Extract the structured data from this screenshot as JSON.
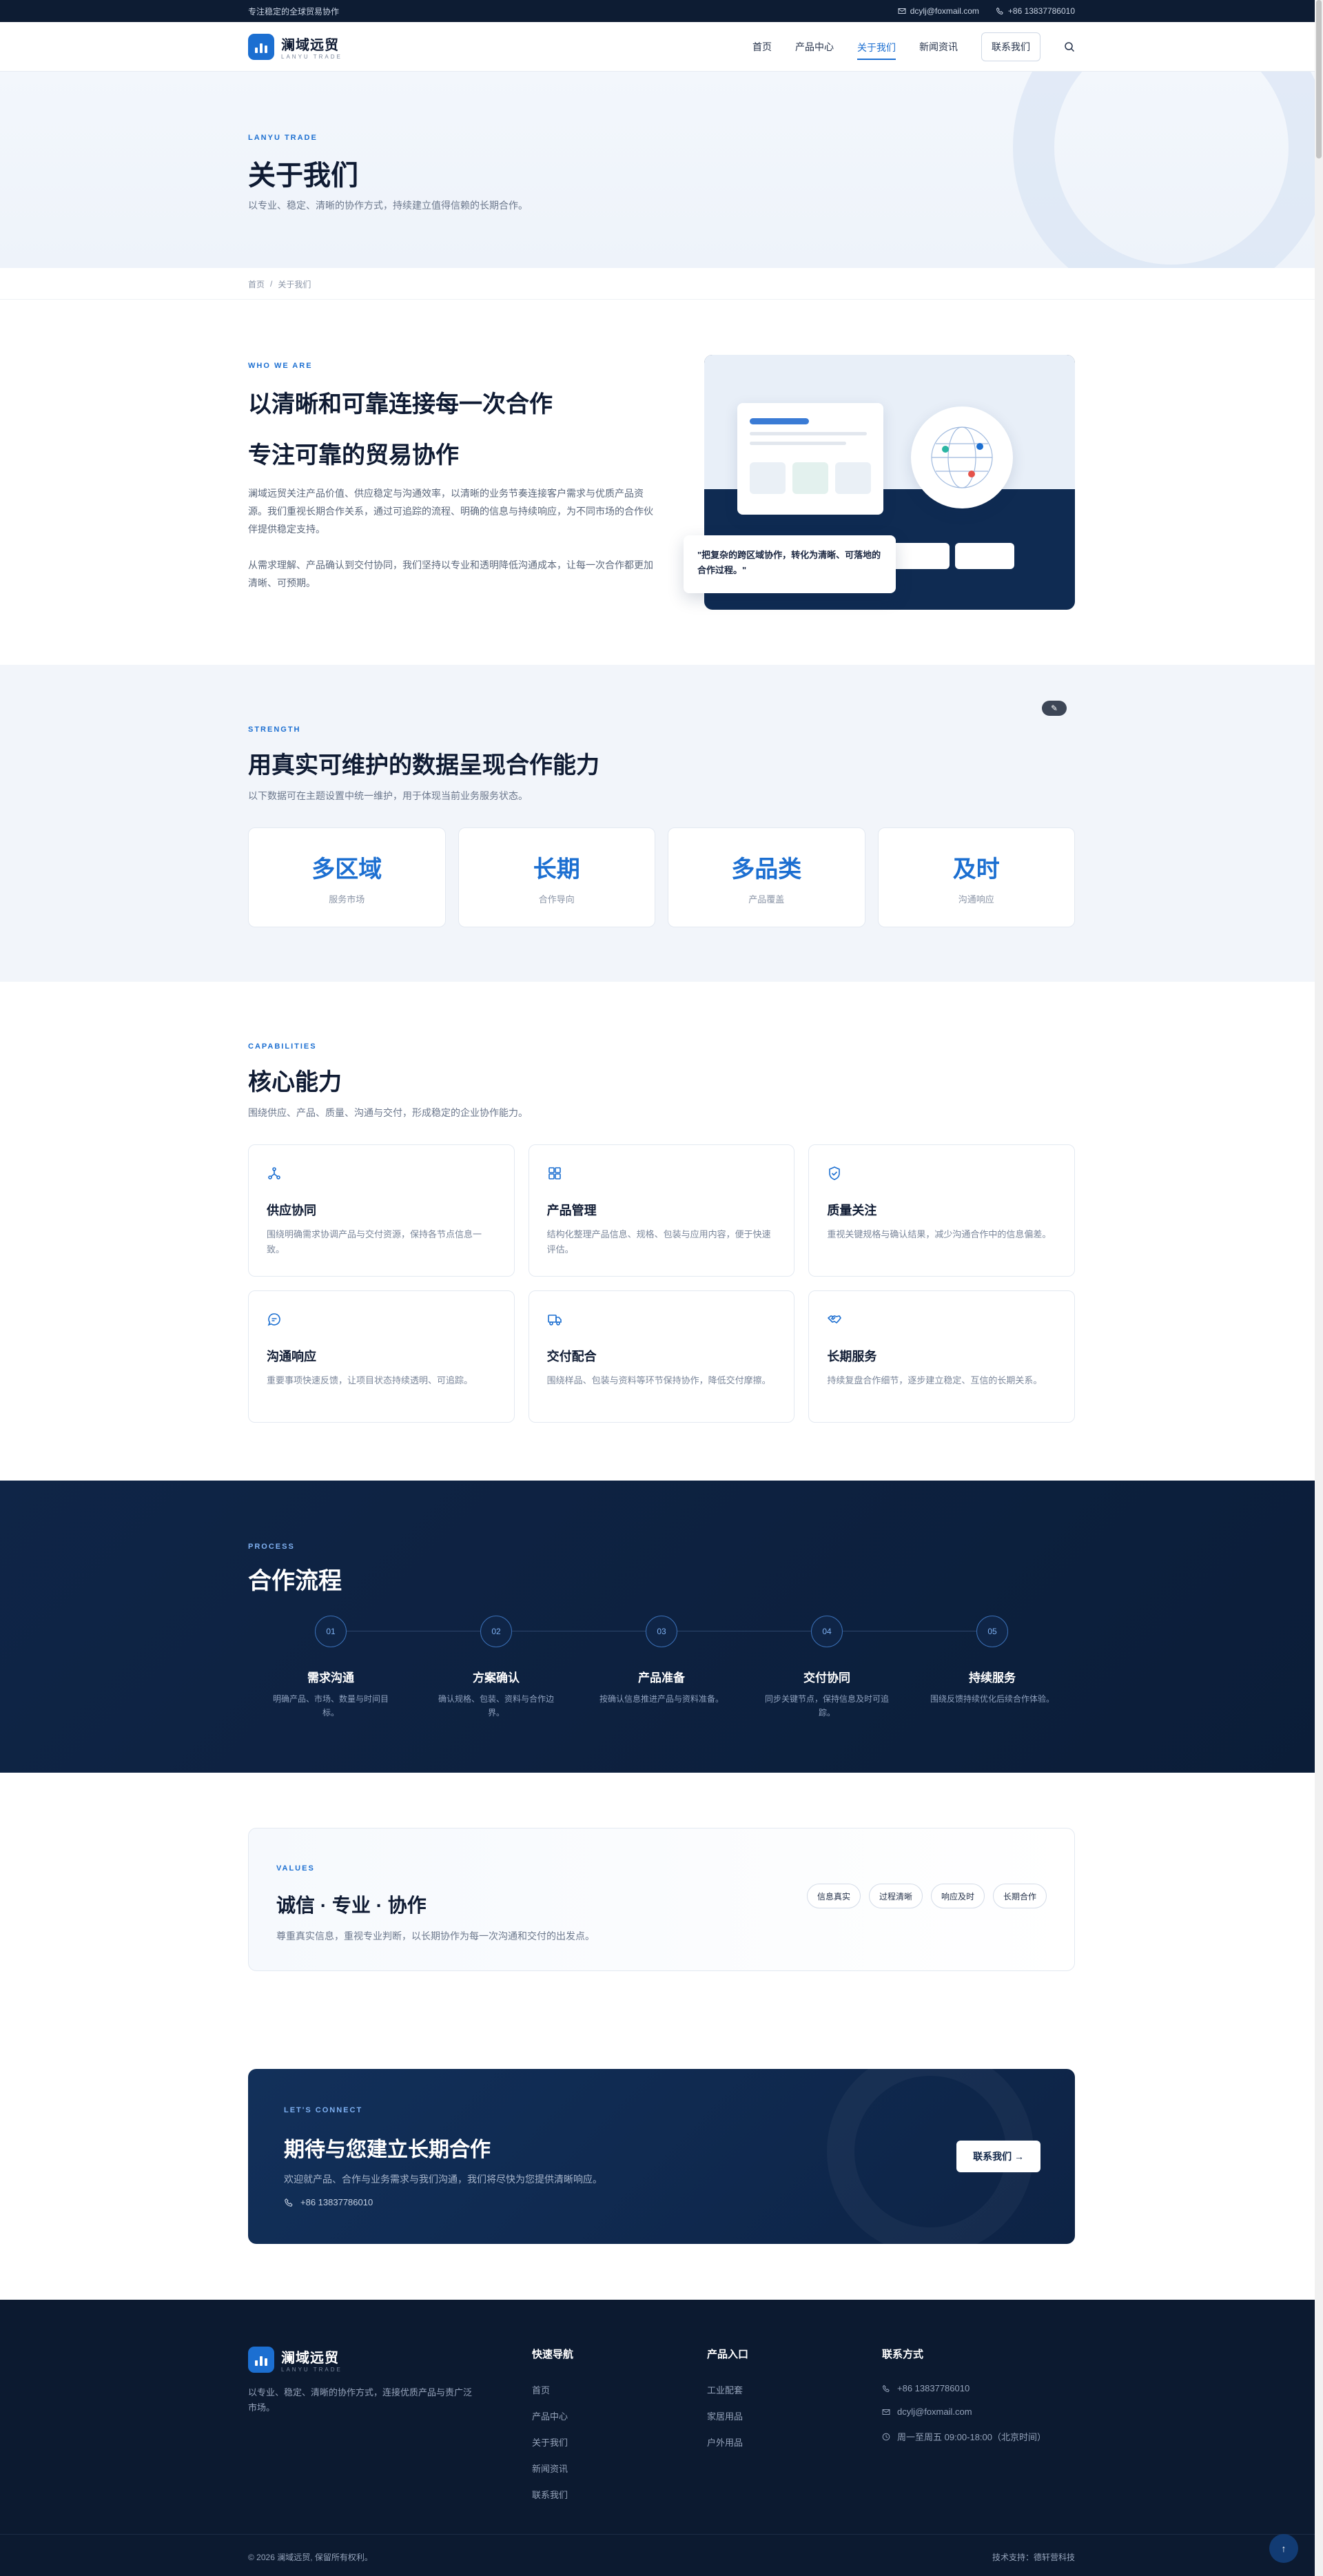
{
  "topbar": {
    "tagline": "专注稳定的全球贸易协作",
    "email": "dcylj@foxmail.com",
    "phone": "+86 13837786010"
  },
  "brand": {
    "name": "澜域远贸",
    "sub": "LANYU TRADE"
  },
  "nav": {
    "items": [
      "首页",
      "产品中心",
      "关于我们",
      "新闻资讯"
    ],
    "active": "关于我们",
    "cta": "联系我们"
  },
  "hero": {
    "eyebrow": "LANYU TRADE",
    "title": "关于我们",
    "subtitle": "以专业、稳定、清晰的协作方式，持续建立值得信赖的长期合作。"
  },
  "breadcrumb": {
    "home": "首页",
    "sep": "/",
    "current": "关于我们"
  },
  "about": {
    "eyebrow": "WHO WE ARE",
    "title1": "以清晰和可靠连接每一次合作",
    "title2": "专注可靠的贸易协作",
    "p1": "澜域远贸关注产品价值、供应稳定与沟通效率，以清晰的业务节奏连接客户需求与优质产品资源。我们重视长期合作关系，通过可追踪的流程、明确的信息与持续响应，为不同市场的合作伙伴提供稳定支持。",
    "p2": "从需求理解、产品确认到交付协同，我们坚持以专业和透明降低沟通成本，让每一次合作都更加清晰、可预期。",
    "quote": "\"把复杂的跨区域协作，转化为清晰、可落地的合作过程。\""
  },
  "strength": {
    "eyebrow": "STRENGTH",
    "title": "用真实可维护的数据呈现合作能力",
    "subtitle": "以下数据可在主题设置中统一维护，用于体现当前业务服务状态。",
    "stats": [
      {
        "value": "多区域",
        "label": "服务市场"
      },
      {
        "value": "长期",
        "label": "合作导向"
      },
      {
        "value": "多品类",
        "label": "产品覆盖"
      },
      {
        "value": "及时",
        "label": "沟通响应"
      }
    ]
  },
  "caps": {
    "eyebrow": "CAPABILITIES",
    "title": "核心能力",
    "subtitle": "围绕供应、产品、质量、沟通与交付，形成稳定的企业协作能力。",
    "items": [
      {
        "icon": "network-icon",
        "title": "供应协同",
        "desc": "围绕明确需求协调产品与交付资源，保持各节点信息一致。"
      },
      {
        "icon": "grid-icon",
        "title": "产品管理",
        "desc": "结构化整理产品信息、规格、包装与应用内容，便于快速评估。"
      },
      {
        "icon": "shield-check-icon",
        "title": "质量关注",
        "desc": "重视关键规格与确认结果，减少沟通合作中的信息偏差。"
      },
      {
        "icon": "chat-icon",
        "title": "沟通响应",
        "desc": "重要事项快速反馈，让项目状态持续透明、可追踪。"
      },
      {
        "icon": "truck-icon",
        "title": "交付配合",
        "desc": "围绕样品、包装与资料等环节保持协作，降低交付摩擦。"
      },
      {
        "icon": "handshake-icon",
        "title": "长期服务",
        "desc": "持续复盘合作细节，逐步建立稳定、互信的长期关系。"
      }
    ]
  },
  "process": {
    "eyebrow": "PROCESS",
    "title": "合作流程",
    "steps": [
      {
        "num": "01",
        "title": "需求沟通",
        "desc": "明确产品、市场、数量与时间目标。"
      },
      {
        "num": "02",
        "title": "方案确认",
        "desc": "确认规格、包装、资料与合作边界。"
      },
      {
        "num": "03",
        "title": "产品准备",
        "desc": "按确认信息推进产品与资料准备。"
      },
      {
        "num": "04",
        "title": "交付协同",
        "desc": "同步关键节点，保持信息及时可追踪。"
      },
      {
        "num": "05",
        "title": "持续服务",
        "desc": "围绕反馈持续优化后续合作体验。"
      }
    ]
  },
  "values": {
    "eyebrow": "VALUES",
    "title": "诚信 · 专业 · 协作",
    "subtitle": "尊重真实信息，重视专业判断，以长期协作为每一次沟通和交付的出发点。",
    "tags": [
      "信息真实",
      "过程清晰",
      "响应及时",
      "长期合作"
    ]
  },
  "cta": {
    "eyebrow": "LET'S CONNECT",
    "title": "期待与您建立长期合作",
    "subtitle": "欢迎就产品、合作与业务需求与我们沟通，我们将尽快为您提供清晰响应。",
    "phone": "+86 13837786010",
    "button": "联系我们 →"
  },
  "footer": {
    "desc": "以专业、稳定、清晰的协作方式，连接优质产品与责广泛市场。",
    "quick_title": "快速导航",
    "quick": [
      "首页",
      "产品中心",
      "关于我们",
      "新闻资讯",
      "联系我们"
    ],
    "products_title": "产品入口",
    "products": [
      "工业配套",
      "家居用品",
      "户外用品"
    ],
    "contact_title": "联系方式",
    "phone": "+86 13837786010",
    "email": "dcylj@foxmail.com",
    "hours": "周一至周五 09:00-18:00（北京时间）",
    "copyright": "© 2026 澜域远贸, 保留所有权利。",
    "support": "技术支持：德轩营科技"
  },
  "colors": {
    "accent": "#1c6fd1",
    "navy": "#0d1c33"
  }
}
